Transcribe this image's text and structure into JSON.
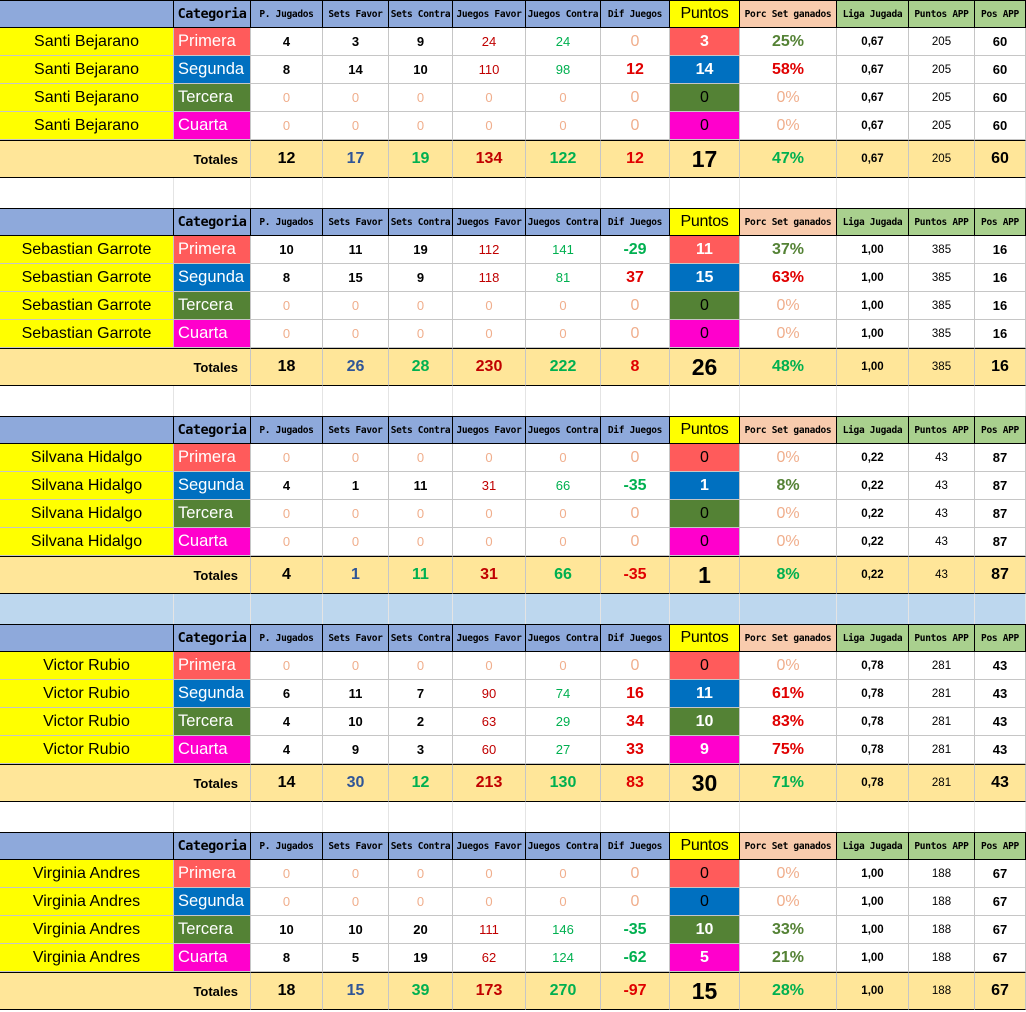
{
  "headers": {
    "categoria": "Categoria",
    "jugados": "P. Jugados",
    "sets_favor": "Sets Favor",
    "sets_contra": "Sets Contra",
    "juegos_favor": "Juegos Favor",
    "juegos_contra": "Juegos Contra",
    "dif_juegos": "Dif Juegos",
    "puntos": "Puntos",
    "porc_set": "Porc Set ganados",
    "liga_jugada": "Liga Jugada",
    "puntos_app": "Puntos APP",
    "pos_app": "Pos APP"
  },
  "totales_label": "Totales",
  "category_colors": {
    "Primera": "#ff5b5b",
    "Segunda": "#0070c0",
    "Tercera": "#548235",
    "Cuarta": "#ff00cc"
  },
  "header_colors": {
    "categoria": "#8ea9db",
    "stats": "#8ea9db",
    "puntos": "#ffff00",
    "porc": "#f8cbad",
    "app": "#a9d08e"
  },
  "blocks": [
    {
      "player": "Santi Bejarano",
      "rows": [
        {
          "cat": "Primera",
          "pj": "4",
          "sf": "3",
          "sc": "9",
          "jf": "24",
          "jc": "24",
          "dif": "0",
          "pts": "3",
          "pct": "25%",
          "liga": "0,67",
          "papp": "205",
          "pos": "60"
        },
        {
          "cat": "Segunda",
          "pj": "8",
          "sf": "14",
          "sc": "10",
          "jf": "110",
          "jc": "98",
          "dif": "12",
          "pts": "14",
          "pct": "58%",
          "liga": "0,67",
          "papp": "205",
          "pos": "60"
        },
        {
          "cat": "Tercera",
          "pj": "0",
          "sf": "0",
          "sc": "0",
          "jf": "0",
          "jc": "0",
          "dif": "0",
          "pts": "0",
          "pct": "0%",
          "liga": "0,67",
          "papp": "205",
          "pos": "60"
        },
        {
          "cat": "Cuarta",
          "pj": "0",
          "sf": "0",
          "sc": "0",
          "jf": "0",
          "jc": "0",
          "dif": "0",
          "pts": "0",
          "pct": "0%",
          "liga": "0,67",
          "papp": "205",
          "pos": "60"
        }
      ],
      "totals": {
        "pj": "12",
        "sf": "17",
        "sc": "19",
        "jf": "134",
        "jc": "122",
        "dif": "12",
        "pts": "17",
        "pct": "47%",
        "liga": "0,67",
        "papp": "205",
        "pos": "60"
      }
    },
    {
      "player": "Sebastian Garrote",
      "rows": [
        {
          "cat": "Primera",
          "pj": "10",
          "sf": "11",
          "sc": "19",
          "jf": "112",
          "jc": "141",
          "dif": "-29",
          "pts": "11",
          "pct": "37%",
          "liga": "1,00",
          "papp": "385",
          "pos": "16"
        },
        {
          "cat": "Segunda",
          "pj": "8",
          "sf": "15",
          "sc": "9",
          "jf": "118",
          "jc": "81",
          "dif": "37",
          "pts": "15",
          "pct": "63%",
          "liga": "1,00",
          "papp": "385",
          "pos": "16"
        },
        {
          "cat": "Tercera",
          "pj": "0",
          "sf": "0",
          "sc": "0",
          "jf": "0",
          "jc": "0",
          "dif": "0",
          "pts": "0",
          "pct": "0%",
          "liga": "1,00",
          "papp": "385",
          "pos": "16"
        },
        {
          "cat": "Cuarta",
          "pj": "0",
          "sf": "0",
          "sc": "0",
          "jf": "0",
          "jc": "0",
          "dif": "0",
          "pts": "0",
          "pct": "0%",
          "liga": "1,00",
          "papp": "385",
          "pos": "16"
        }
      ],
      "totals": {
        "pj": "18",
        "sf": "26",
        "sc": "28",
        "jf": "230",
        "jc": "222",
        "dif": "8",
        "pts": "26",
        "pct": "48%",
        "liga": "1,00",
        "papp": "385",
        "pos": "16"
      }
    },
    {
      "player": "Silvana Hidalgo",
      "rows": [
        {
          "cat": "Primera",
          "pj": "0",
          "sf": "0",
          "sc": "0",
          "jf": "0",
          "jc": "0",
          "dif": "0",
          "pts": "0",
          "pct": "0%",
          "liga": "0,22",
          "papp": "43",
          "pos": "87"
        },
        {
          "cat": "Segunda",
          "pj": "4",
          "sf": "1",
          "sc": "11",
          "jf": "31",
          "jc": "66",
          "dif": "-35",
          "pts": "1",
          "pct": "8%",
          "liga": "0,22",
          "papp": "43",
          "pos": "87"
        },
        {
          "cat": "Tercera",
          "pj": "0",
          "sf": "0",
          "sc": "0",
          "jf": "0",
          "jc": "0",
          "dif": "0",
          "pts": "0",
          "pct": "0%",
          "liga": "0,22",
          "papp": "43",
          "pos": "87"
        },
        {
          "cat": "Cuarta",
          "pj": "0",
          "sf": "0",
          "sc": "0",
          "jf": "0",
          "jc": "0",
          "dif": "0",
          "pts": "0",
          "pct": "0%",
          "liga": "0,22",
          "papp": "43",
          "pos": "87"
        }
      ],
      "totals": {
        "pj": "4",
        "sf": "1",
        "sc": "11",
        "jf": "31",
        "jc": "66",
        "dif": "-35",
        "pts": "1",
        "pct": "8%",
        "liga": "0,22",
        "papp": "43",
        "pos": "87"
      }
    },
    {
      "player": "Victor Rubio",
      "rows": [
        {
          "cat": "Primera",
          "pj": "0",
          "sf": "0",
          "sc": "0",
          "jf": "0",
          "jc": "0",
          "dif": "0",
          "pts": "0",
          "pct": "0%",
          "liga": "0,78",
          "papp": "281",
          "pos": "43"
        },
        {
          "cat": "Segunda",
          "pj": "6",
          "sf": "11",
          "sc": "7",
          "jf": "90",
          "jc": "74",
          "dif": "16",
          "pts": "11",
          "pct": "61%",
          "liga": "0,78",
          "papp": "281",
          "pos": "43"
        },
        {
          "cat": "Tercera",
          "pj": "4",
          "sf": "10",
          "sc": "2",
          "jf": "63",
          "jc": "29",
          "dif": "34",
          "pts": "10",
          "pct": "83%",
          "liga": "0,78",
          "papp": "281",
          "pos": "43"
        },
        {
          "cat": "Cuarta",
          "pj": "4",
          "sf": "9",
          "sc": "3",
          "jf": "60",
          "jc": "27",
          "dif": "33",
          "pts": "9",
          "pct": "75%",
          "liga": "0,78",
          "papp": "281",
          "pos": "43"
        }
      ],
      "totals": {
        "pj": "14",
        "sf": "30",
        "sc": "12",
        "jf": "213",
        "jc": "130",
        "dif": "83",
        "pts": "30",
        "pct": "71%",
        "liga": "0,78",
        "papp": "281",
        "pos": "43"
      }
    },
    {
      "player": "Virginia Andres",
      "rows": [
        {
          "cat": "Primera",
          "pj": "0",
          "sf": "0",
          "sc": "0",
          "jf": "0",
          "jc": "0",
          "dif": "0",
          "pts": "0",
          "pct": "0%",
          "liga": "1,00",
          "papp": "188",
          "pos": "67"
        },
        {
          "cat": "Segunda",
          "pj": "0",
          "sf": "0",
          "sc": "0",
          "jf": "0",
          "jc": "0",
          "dif": "0",
          "pts": "0",
          "pct": "0%",
          "liga": "1,00",
          "papp": "188",
          "pos": "67"
        },
        {
          "cat": "Tercera",
          "pj": "10",
          "sf": "10",
          "sc": "20",
          "jf": "111",
          "jc": "146",
          "dif": "-35",
          "pts": "10",
          "pct": "33%",
          "liga": "1,00",
          "papp": "188",
          "pos": "67"
        },
        {
          "cat": "Cuarta",
          "pj": "8",
          "sf": "5",
          "sc": "19",
          "jf": "62",
          "jc": "124",
          "dif": "-62",
          "pts": "5",
          "pct": "21%",
          "liga": "1,00",
          "papp": "188",
          "pos": "67"
        }
      ],
      "totals": {
        "pj": "18",
        "sf": "15",
        "sc": "39",
        "jf": "173",
        "jc": "270",
        "dif": "-97",
        "pts": "15",
        "pct": "28%",
        "liga": "1,00",
        "papp": "188",
        "pos": "67"
      }
    }
  ]
}
